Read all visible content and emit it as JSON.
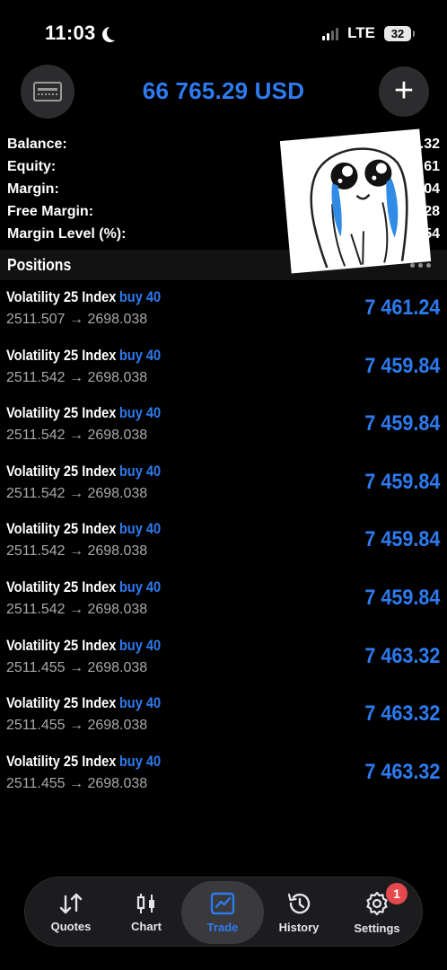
{
  "status_bar": {
    "time": "11:03",
    "network": "LTE",
    "battery": "32"
  },
  "header": {
    "total": "66 765.29 USD"
  },
  "account": {
    "rows": [
      {
        "label": "Balance:",
        "value": "1.32"
      },
      {
        "label": "Equity:",
        "value": "6.61"
      },
      {
        "label": "Margin:",
        "value": "04"
      },
      {
        "label": "Free Margin:",
        "value": "28"
      },
      {
        "label": "Margin Level (%):",
        "value": "54"
      }
    ]
  },
  "positions": {
    "title": "Positions",
    "items": [
      {
        "symbol": "Volatility 25 Index",
        "side": "buy 40",
        "prices": "2511.507 → 2698.038",
        "profit": "7 461.24"
      },
      {
        "symbol": "Volatility 25 Index",
        "side": "buy 40",
        "prices": "2511.542 → 2698.038",
        "profit": "7 459.84"
      },
      {
        "symbol": "Volatility 25 Index",
        "side": "buy 40",
        "prices": "2511.542 → 2698.038",
        "profit": "7 459.84"
      },
      {
        "symbol": "Volatility 25 Index",
        "side": "buy 40",
        "prices": "2511.542 → 2698.038",
        "profit": "7 459.84"
      },
      {
        "symbol": "Volatility 25 Index",
        "side": "buy 40",
        "prices": "2511.542 → 2698.038",
        "profit": "7 459.84"
      },
      {
        "symbol": "Volatility 25 Index",
        "side": "buy 40",
        "prices": "2511.542 → 2698.038",
        "profit": "7 459.84"
      },
      {
        "symbol": "Volatility 25 Index",
        "side": "buy 40",
        "prices": "2511.455 → 2698.038",
        "profit": "7 463.32"
      },
      {
        "symbol": "Volatility 25 Index",
        "side": "buy 40",
        "prices": "2511.455 → 2698.038",
        "profit": "7 463.32"
      },
      {
        "symbol": "Volatility 25 Index",
        "side": "buy 40",
        "prices": "2511.455 → 2698.038",
        "profit": "7 463.32"
      }
    ]
  },
  "tabbar": {
    "tabs": [
      {
        "label": "Quotes",
        "icon": "quotes-arrows-icon"
      },
      {
        "label": "Chart",
        "icon": "candlestick-icon"
      },
      {
        "label": "Trade",
        "icon": "trade-chart-icon",
        "active": true
      },
      {
        "label": "History",
        "icon": "history-clock-icon"
      },
      {
        "label": "Settings",
        "icon": "gear-icon",
        "badge": "1"
      }
    ]
  },
  "colors": {
    "accent": "#2e7bf0",
    "background": "#000000",
    "badge": "#e5484d"
  }
}
